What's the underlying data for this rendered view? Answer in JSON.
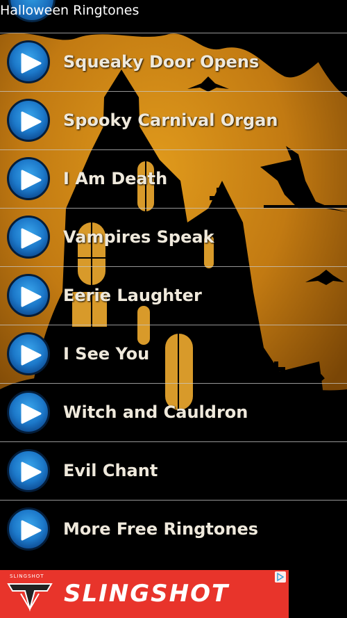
{
  "app": {
    "title": "Halloween Ringtones"
  },
  "ringtones": [
    {
      "label": "Squeaky Door Opens"
    },
    {
      "label": "Spooky Carnival Organ"
    },
    {
      "label": "I Am Death"
    },
    {
      "label": "Vampires Speak"
    },
    {
      "label": "Eerie Laughter"
    },
    {
      "label": "I See You"
    },
    {
      "label": "Witch and Cauldron"
    },
    {
      "label": "Evil Chant"
    },
    {
      "label": "More Free Ringtones"
    }
  ],
  "ad": {
    "brand": "SLINGSHOT",
    "brand_small": "SLINGSHOT",
    "choices_icon": "ad-choices-icon"
  },
  "colors": {
    "sky": "#c98614",
    "text": "#efe9dc",
    "play_blue": "#1c78c9",
    "ad_red": "#e8342b"
  }
}
